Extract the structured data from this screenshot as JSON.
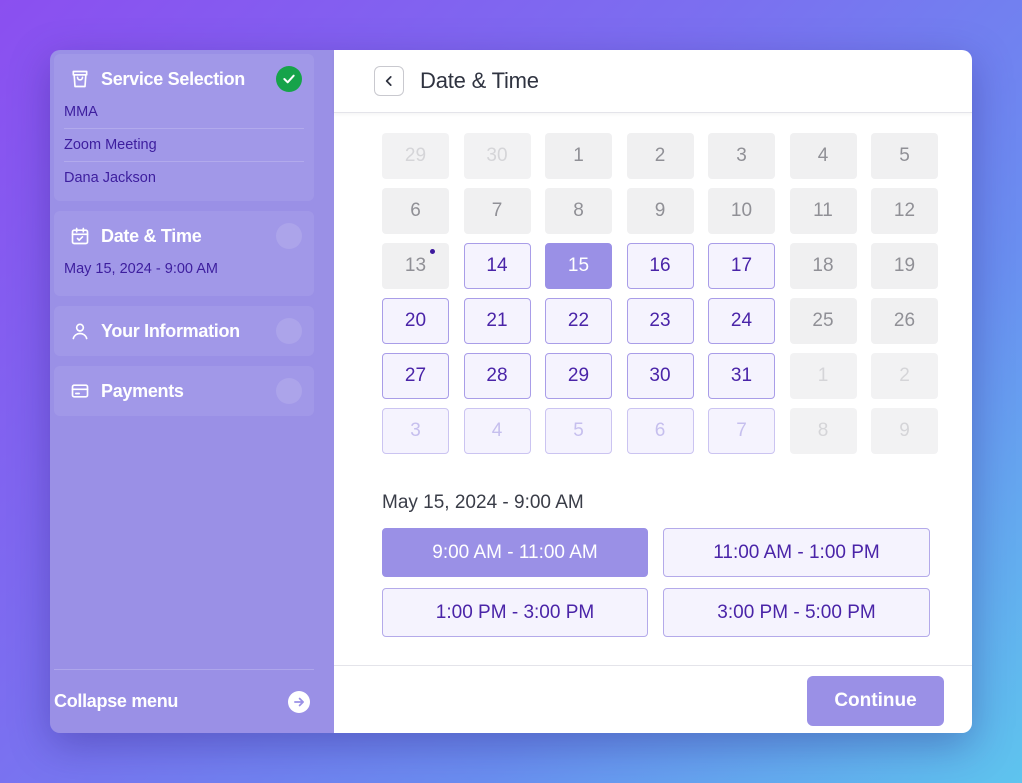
{
  "sidebar": {
    "steps": [
      {
        "title": "Service Selection",
        "icon": "shopping-bag-icon",
        "status": "done",
        "items": [
          "MMA",
          "Zoom Meeting",
          "Dana Jackson"
        ]
      },
      {
        "title": "Date & Time",
        "icon": "calendar-icon",
        "status": "active",
        "items": [
          "May 15, 2024 - 9:00 AM"
        ]
      },
      {
        "title": "Your Information",
        "icon": "user-icon",
        "status": "pending",
        "items": []
      },
      {
        "title": "Payments",
        "icon": "credit-card-icon",
        "status": "pending",
        "items": []
      }
    ],
    "collapse_label": "Collapse menu"
  },
  "header": {
    "title": "Date & Time"
  },
  "calendar": {
    "days": [
      {
        "label": "29",
        "state": "out"
      },
      {
        "label": "30",
        "state": "out"
      },
      {
        "label": "1",
        "state": "dis"
      },
      {
        "label": "2",
        "state": "dis"
      },
      {
        "label": "3",
        "state": "dis"
      },
      {
        "label": "4",
        "state": "dis"
      },
      {
        "label": "5",
        "state": "dis"
      },
      {
        "label": "6",
        "state": "dis"
      },
      {
        "label": "7",
        "state": "dis"
      },
      {
        "label": "8",
        "state": "dis"
      },
      {
        "label": "9",
        "state": "dis"
      },
      {
        "label": "10",
        "state": "dis"
      },
      {
        "label": "11",
        "state": "dis"
      },
      {
        "label": "12",
        "state": "dis"
      },
      {
        "label": "13",
        "state": "dis",
        "today": true
      },
      {
        "label": "14",
        "state": "av"
      },
      {
        "label": "15",
        "state": "sel"
      },
      {
        "label": "16",
        "state": "av"
      },
      {
        "label": "17",
        "state": "av"
      },
      {
        "label": "18",
        "state": "dis"
      },
      {
        "label": "19",
        "state": "dis"
      },
      {
        "label": "20",
        "state": "av"
      },
      {
        "label": "21",
        "state": "av"
      },
      {
        "label": "22",
        "state": "av"
      },
      {
        "label": "23",
        "state": "av"
      },
      {
        "label": "24",
        "state": "av"
      },
      {
        "label": "25",
        "state": "dis"
      },
      {
        "label": "26",
        "state": "dis"
      },
      {
        "label": "27",
        "state": "av"
      },
      {
        "label": "28",
        "state": "av"
      },
      {
        "label": "29",
        "state": "av"
      },
      {
        "label": "30",
        "state": "av"
      },
      {
        "label": "31",
        "state": "av"
      },
      {
        "label": "1",
        "state": "out"
      },
      {
        "label": "2",
        "state": "out"
      },
      {
        "label": "3",
        "state": "avfaded"
      },
      {
        "label": "4",
        "state": "avfaded"
      },
      {
        "label": "5",
        "state": "avfaded"
      },
      {
        "label": "6",
        "state": "avfaded"
      },
      {
        "label": "7",
        "state": "avfaded"
      },
      {
        "label": "8",
        "state": "out"
      },
      {
        "label": "9",
        "state": "out"
      }
    ]
  },
  "selection": {
    "label": "May 15, 2024 - 9:00 AM"
  },
  "slots": [
    {
      "label": "9:00 AM - 11:00 AM",
      "selected": true
    },
    {
      "label": "11:00 AM - 1:00 PM",
      "selected": false
    },
    {
      "label": "1:00 PM - 3:00 PM",
      "selected": false
    },
    {
      "label": "3:00 PM - 5:00 PM",
      "selected": false
    }
  ],
  "footer": {
    "continue_label": "Continue"
  },
  "colors": {
    "accent": "#9a90e6",
    "accent_text": "#4a24a8",
    "success": "#16a34a"
  }
}
